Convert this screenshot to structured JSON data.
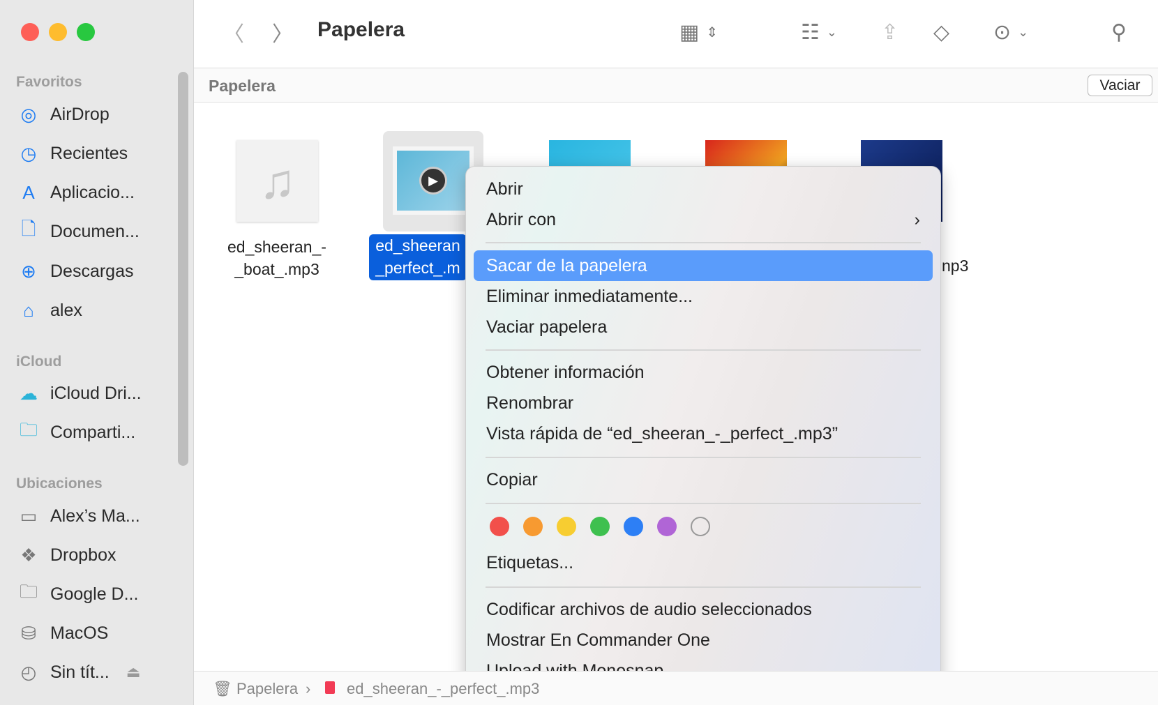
{
  "window": {
    "title": "Papelera",
    "traffic_lights": {
      "close": "#fe5f57",
      "minimize": "#febc2e",
      "zoom": "#28c840"
    }
  },
  "sidebar": {
    "sections": [
      {
        "label": "Favoritos",
        "items": [
          {
            "label": "AirDrop",
            "icon": "airdrop-icon"
          },
          {
            "label": "Recientes",
            "icon": "clock-icon"
          },
          {
            "label": "Aplicacio...",
            "icon": "apps-icon"
          },
          {
            "label": "Documen...",
            "icon": "document-icon"
          },
          {
            "label": "Descargas",
            "icon": "download-icon"
          },
          {
            "label": "alex",
            "icon": "home-icon"
          }
        ]
      },
      {
        "label": "iCloud",
        "items": [
          {
            "label": "iCloud Dri...",
            "icon": "cloud-icon"
          },
          {
            "label": "Comparti...",
            "icon": "shared-folder-icon"
          }
        ]
      },
      {
        "label": "Ubicaciones",
        "items": [
          {
            "label": "Alex’s Ma...",
            "icon": "laptop-icon"
          },
          {
            "label": "Dropbox",
            "icon": "dropbox-icon"
          },
          {
            "label": "Google D...",
            "icon": "folder-icon"
          },
          {
            "label": "MacOS",
            "icon": "disk-icon"
          },
          {
            "label": "Sin tít...",
            "icon": "time-machine-icon"
          }
        ]
      }
    ]
  },
  "header": {
    "path_title": "Papelera",
    "empty_button": "Vaciar"
  },
  "files": [
    {
      "line1": "ed_sheeran_-",
      "line2": "_boat_.mp3"
    },
    {
      "line1": "ed_sheeran",
      "line2": "_perfect_.m",
      "selected": true
    },
    {
      "line2": "np3"
    }
  ],
  "context_menu": {
    "items": [
      "Abrir",
      "Abrir con",
      "Sacar de la papelera",
      "Eliminar inmediatamente...",
      "Vaciar papelera",
      "Obtener información",
      "Renombrar",
      "Vista rápida de “ed_sheeran_-_perfect_.mp3”",
      "Copiar",
      "Etiquetas...",
      "Codificar archivos de audio seleccionados",
      "Mostrar En Commander One",
      "Upload with Monosnap"
    ],
    "highlighted": "Sacar de la papelera",
    "tag_colors": [
      "#f2504b",
      "#f79a31",
      "#f7cd31",
      "#3ec04f",
      "#2d7ff5",
      "#b065d6",
      "none"
    ],
    "accent": "#5a9cfb"
  },
  "pathbar": {
    "items": [
      "Papelera",
      "ed_sheeran_-_perfect_.mp3"
    ]
  }
}
